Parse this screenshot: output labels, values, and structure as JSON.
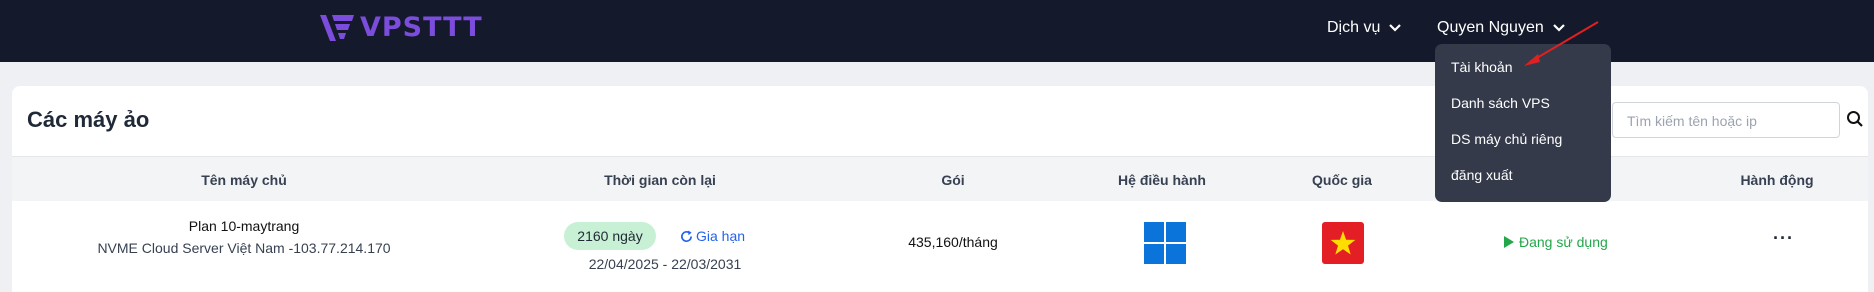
{
  "header": {
    "logo_text": "VPSTTT",
    "nav_services": "Dịch vụ",
    "user_name": "Quyen Nguyen"
  },
  "user_menu": {
    "items": [
      "Tài khoản",
      "Danh sách VPS",
      "DS máy chủ riêng",
      "đăng xuất"
    ]
  },
  "main": {
    "title": "Các máy ảo",
    "search_placeholder": "Tìm kiếm tên hoặc ip"
  },
  "table": {
    "headers": [
      "Tên máy chủ",
      "Thời gian còn lại",
      "Gói",
      "Hệ điều hành",
      "Quốc gia",
      "Hành động"
    ],
    "rows": [
      {
        "name": "Plan 10-maytrang",
        "desc": "NVME Cloud Server Việt Nam -103.77.214.170",
        "days": "2160 ngày",
        "extend": "Gia hạn",
        "dates": "22/04/2025 - 22/03/2031",
        "price": "435,160/tháng",
        "os_icon": "windows-logo-icon",
        "country_icon": "vietnam-flag-icon",
        "status": "Đang sử dụng",
        "action": "···"
      }
    ]
  },
  "colors": {
    "topbar": "#141a2b",
    "brand": "#7c4ddc",
    "dropdown": "#343a4a",
    "link": "#2563eb",
    "status_active": "#22a74a",
    "badge_bg": "#c8f0d4",
    "annotation_arrow": "#e02020"
  }
}
